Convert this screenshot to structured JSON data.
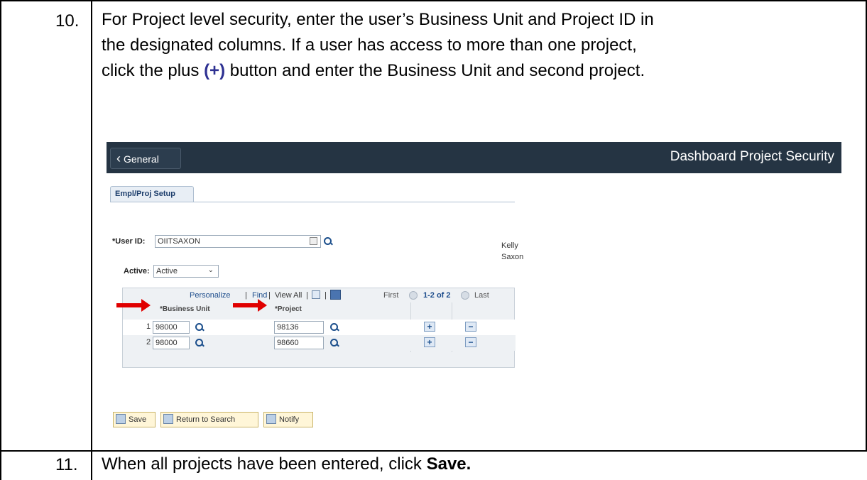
{
  "steps": [
    {
      "number": "10.",
      "line1": "For Project level security, enter the user’s Business Unit and Project ID in",
      "line2": "the designated columns. If a user has access to more than one project,",
      "line3_before": "click the plus ",
      "line3_plus": "(+)",
      "line3_after": " button and enter the Business Unit and second project."
    },
    {
      "number": "11.",
      "text_before": "When all projects have been entered, click ",
      "text_bold": "Save."
    }
  ],
  "screenshot": {
    "back_label": "General",
    "page_title": "Dashboard Project Security",
    "tab_label": "Empl/Proj Setup",
    "user_id_label": "*User ID:",
    "user_id_value": "OIITSAXON",
    "name_first": "Kelly",
    "name_last": "Saxon",
    "active_label": "Active:",
    "active_value": "Active",
    "grid_nav": {
      "personalize": "Personalize",
      "find": "Find",
      "view_all": "View All",
      "first": "First",
      "range": "1-2 of 2",
      "last": "Last"
    },
    "columns": [
      "*Business Unit",
      "*Project"
    ],
    "rows": [
      {
        "num": "1",
        "business_unit": "98000",
        "project": "98136"
      },
      {
        "num": "2",
        "business_unit": "98000",
        "project": "98660"
      }
    ],
    "buttons": {
      "save": "Save",
      "return_to_search": "Return to Search",
      "notify": "Notify"
    },
    "colors": {
      "banner": "#253443",
      "arrow": "#e00000",
      "plus_ref": "#2e3192"
    }
  }
}
